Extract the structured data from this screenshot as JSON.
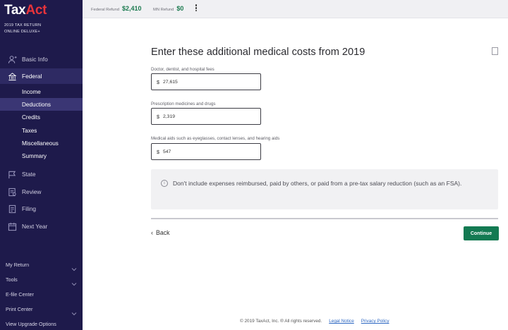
{
  "brand": {
    "part1": "Tax",
    "part2": "Act"
  },
  "sidebar": {
    "return_line1": "2019 TAX RETURN",
    "return_line2": "ONLINE DELUXE+",
    "nav": [
      {
        "label": "Basic Info",
        "icon": "person-icon"
      },
      {
        "label": "Federal",
        "icon": "capitol-icon",
        "active": true
      },
      {
        "label": "State",
        "icon": "flag-icon"
      },
      {
        "label": "Review",
        "icon": "review-icon"
      },
      {
        "label": "Filing",
        "icon": "document-icon"
      },
      {
        "label": "Next Year",
        "icon": "calendar-icon"
      }
    ],
    "federal_sub": [
      "Income",
      "Deductions",
      "Credits",
      "Taxes",
      "Miscellaneous",
      "Summary"
    ],
    "active_sub": "Deductions",
    "bottom": [
      {
        "label": "My Return",
        "has_chevron": true
      },
      {
        "label": "Tools",
        "has_chevron": true
      },
      {
        "label": "E-file Center",
        "has_chevron": false
      },
      {
        "label": "Print Center",
        "has_chevron": true
      },
      {
        "label": "View Upgrade Options",
        "has_chevron": false
      }
    ]
  },
  "topbar": {
    "federal_label": "Federal Refund",
    "federal_value": "$2,410",
    "state_label": "MN Refund",
    "state_value": "$0"
  },
  "main": {
    "title": "Enter these additional medical costs from 2019",
    "fields": [
      {
        "label": "Doctor, dentist, and hospital fees",
        "currency": "$",
        "value": "27,615"
      },
      {
        "label": "Prescription medicines and drugs",
        "currency": "$",
        "value": "2,319"
      },
      {
        "label": "Medical aids such as eyeglasses, contact lenses, and hearing aids",
        "currency": "$",
        "value": "547"
      }
    ],
    "info_icon": "i",
    "info": "Don't include expenses reimbursed, paid by others, or paid from a pre-tax salary reduction (such as an FSA).",
    "back_label": "Back",
    "continue_label": "Continue"
  },
  "footer": {
    "copyright": "© 2019 TaxAct, Inc. ® All rights reserved.",
    "legal_notice": "Legal Notice",
    "privacy": "Privacy Policy"
  },
  "colors": {
    "sidebar": "#1e1a4b",
    "accent_red": "#e8343b",
    "continue": "#137a52",
    "refund_green": "#1b7a4f"
  }
}
